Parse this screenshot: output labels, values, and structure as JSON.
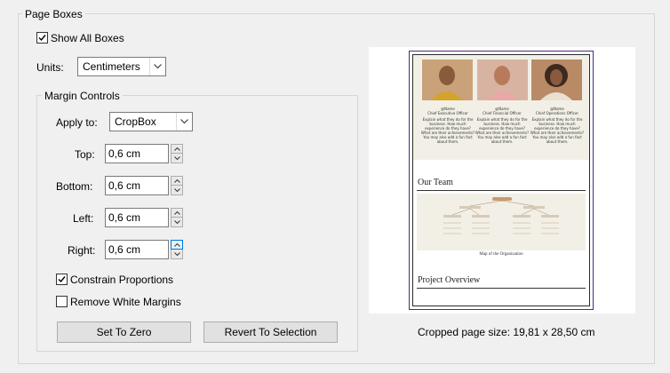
{
  "page_boxes": {
    "title": "Page Boxes",
    "show_all_boxes_label": "Show All Boxes",
    "show_all_boxes_checked": true,
    "units_label": "Units:",
    "units_value": "Centimeters"
  },
  "margin_controls": {
    "title": "Margin Controls",
    "apply_to_label": "Apply to:",
    "apply_to_value": "CropBox",
    "fields": [
      {
        "label": "Top:",
        "value": "0,6 cm"
      },
      {
        "label": "Bottom:",
        "value": "0,6 cm"
      },
      {
        "label": "Left:",
        "value": "0,6 cm"
      },
      {
        "label": "Right:",
        "value": "0,6 cm"
      }
    ],
    "constrain_label": "Constrain Proportions",
    "constrain_checked": true,
    "remove_white_label": "Remove White Margins",
    "remove_white_checked": false,
    "set_zero_label": "Set To Zero",
    "revert_label": "Revert To Selection"
  },
  "preview": {
    "cropped_size": "Cropped page size: 19,81 x 28,50 cm",
    "people": [
      {
        "name": "@Name",
        "role": "Chief Executive Officer",
        "text": [
          "Explain what they do for the",
          "business. How much",
          "experience do they have?",
          "What are their achievements?",
          "You may also add a fun fact",
          "about them."
        ]
      },
      {
        "name": "@Name",
        "role": "Chief Financial Officer",
        "text": [
          "Explain what they do for the",
          "business. How much",
          "experience do they have?",
          "What are their achievements?",
          "You may also add a fun fact",
          "about them."
        ]
      },
      {
        "name": "@Name",
        "role": "Chief Operations Officer",
        "text": [
          "Explain what they do for the",
          "business. How much",
          "experience do they have?",
          "What are their achievements?",
          "You may also add a fun fact",
          "about them."
        ]
      }
    ],
    "section1": "Our Team",
    "org_caption": "Map of the Organization",
    "section2": "Project Overview",
    "accent_bg": "#f2f0e6",
    "photo_colors": [
      "#c9a27a",
      "#d9b3a2",
      "#b88a66"
    ]
  }
}
